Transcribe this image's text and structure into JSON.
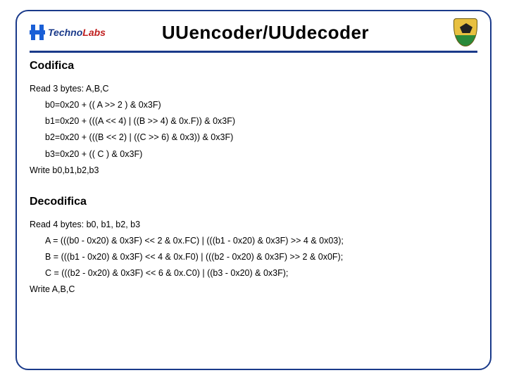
{
  "logo": {
    "brand_prefix": "Techno",
    "brand_suffix": "Labs"
  },
  "title": "UUencoder/UUdecoder",
  "codifica": {
    "heading": "Codifica",
    "read": "Read 3 bytes: A,B,C",
    "b0": "b0=0x20 + (( A >> 2 ) & 0x3F)",
    "b1": "b1=0x20 + (((A << 4) | ((B >> 4) & 0x.F)) & 0x3F)",
    "b2": "b2=0x20 + (((B << 2) | ((C >> 6) & 0x3)) & 0x3F)",
    "b3": "b3=0x20 + (( C ) & 0x3F)",
    "write": "Write b0,b1,b2,b3"
  },
  "decodifica": {
    "heading": "Decodifica",
    "read": "Read 4 bytes: b0, b1, b2, b3",
    "a": "A = (((b0 - 0x20) & 0x3F) << 2 & 0x.FC) | (((b1 - 0x20) & 0x3F) >> 4 & 0x03);",
    "b": "B = (((b1 - 0x20) & 0x3F) << 4 & 0x.F0) | (((b2 - 0x20) & 0x3F) >> 2 & 0x0F);",
    "c": "C = (((b2 - 0x20) & 0x3F) << 6 & 0x.C0) | ((b3 - 0x20) & 0x3F);",
    "write": "Write A,B,C"
  }
}
